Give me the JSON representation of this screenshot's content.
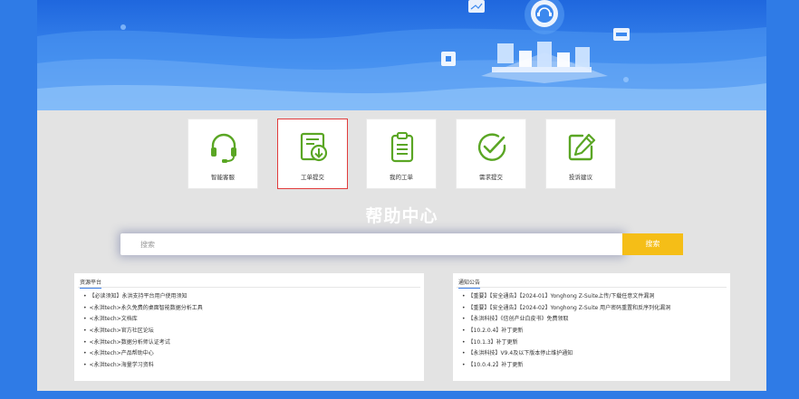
{
  "cards": [
    {
      "label": "智能客服",
      "icon": "headset-icon"
    },
    {
      "label": "工单提交",
      "icon": "ticket-submit-icon"
    },
    {
      "label": "我的工单",
      "icon": "clipboard-icon"
    },
    {
      "label": "需求提交",
      "icon": "check-circle-icon"
    },
    {
      "label": "投诉建议",
      "icon": "edit-icon"
    }
  ],
  "title": "帮助中心",
  "search": {
    "placeholder": "搜索",
    "button_label": "搜索"
  },
  "resources": {
    "title": "资源平台",
    "items": [
      "【必读须知】永洪支持平台用户使用须知",
      "<永洪tech>永久免费的桌面智能数据分析工具",
      "<永洪tech>文档库",
      "<永洪tech>官方社区论坛",
      "<永洪tech>数据分析师认证考试",
      "<永洪tech>产品帮助中心",
      "<永洪tech>海量学习资料"
    ]
  },
  "notices": {
    "title": "通知公告",
    "items": [
      "【重要】【安全通告】【2024-01】Yonghong Z-Suite上传/下载任意文件漏洞",
      "【重要】【安全通告】【2024-02】Yonghong Z-Suite 用户密码重置和反序列化漏洞",
      "【永洪科技】《信创产业白皮书》免费领取",
      "【10.2.0.4】补丁更新",
      "【10.1.3】补丁更新",
      "【永洪科技】V9.4及以下版本停止维护通知",
      "【10.0.4.2】补丁更新"
    ]
  },
  "colors": {
    "accent": "#2f7be6",
    "icon_green": "#5aa624",
    "search_button": "#f5be17",
    "active_border": "#e13b3b"
  }
}
